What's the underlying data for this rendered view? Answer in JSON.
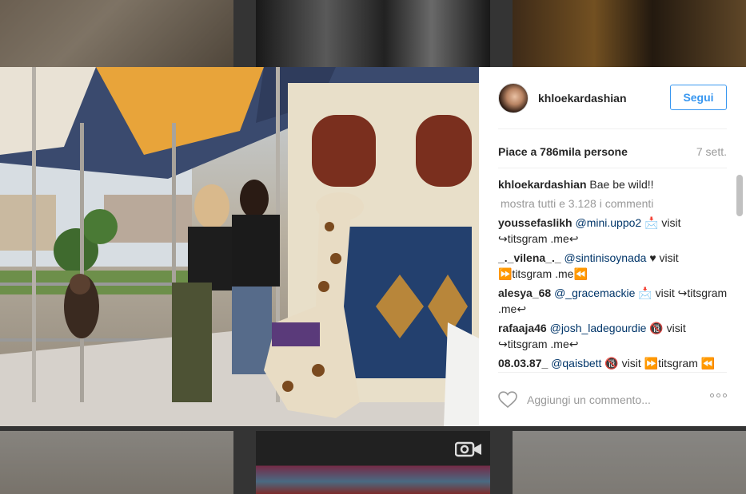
{
  "post": {
    "username": "khloekardashian",
    "follow_label": "Segui",
    "likes": "Piace a 786mila persone",
    "time": "7 sett.",
    "caption_user": "khloekardashian",
    "caption_text": "Bae be wild!!",
    "more_comments": "mostra tutti e 3.128 i commenti",
    "comments": [
      {
        "user": "youssefaslikh",
        "mention": "@mini.uppo2",
        "text": " 📩 visit ↪titsgram .me↩"
      },
      {
        "user": "_._vilena_._",
        "mention": "@sintinisoynada",
        "text": " ♥ visit ⏩titsgram .me⏪"
      },
      {
        "user": "alesya_68",
        "mention": "@_gracemackie",
        "text": " 📩 visit ↪titsgram .me↩"
      },
      {
        "user": "rafaaja46",
        "mention": "@josh_ladegourdie",
        "text": " 🔞 visit ↪titsgram .me↩"
      },
      {
        "user": "08.03.87_",
        "mention": "@qaisbett",
        "text": " 🔞 visit ⏩titsgram ⏪"
      }
    ],
    "comment_placeholder": "Aggiungi un commento...",
    "colors": {
      "accent": "#3897f0",
      "text": "#262626",
      "muted": "#999999",
      "mention": "#003569"
    }
  },
  "icons": {
    "like": "heart-icon",
    "options": "more-options-icon",
    "video": "video-camera-icon"
  }
}
